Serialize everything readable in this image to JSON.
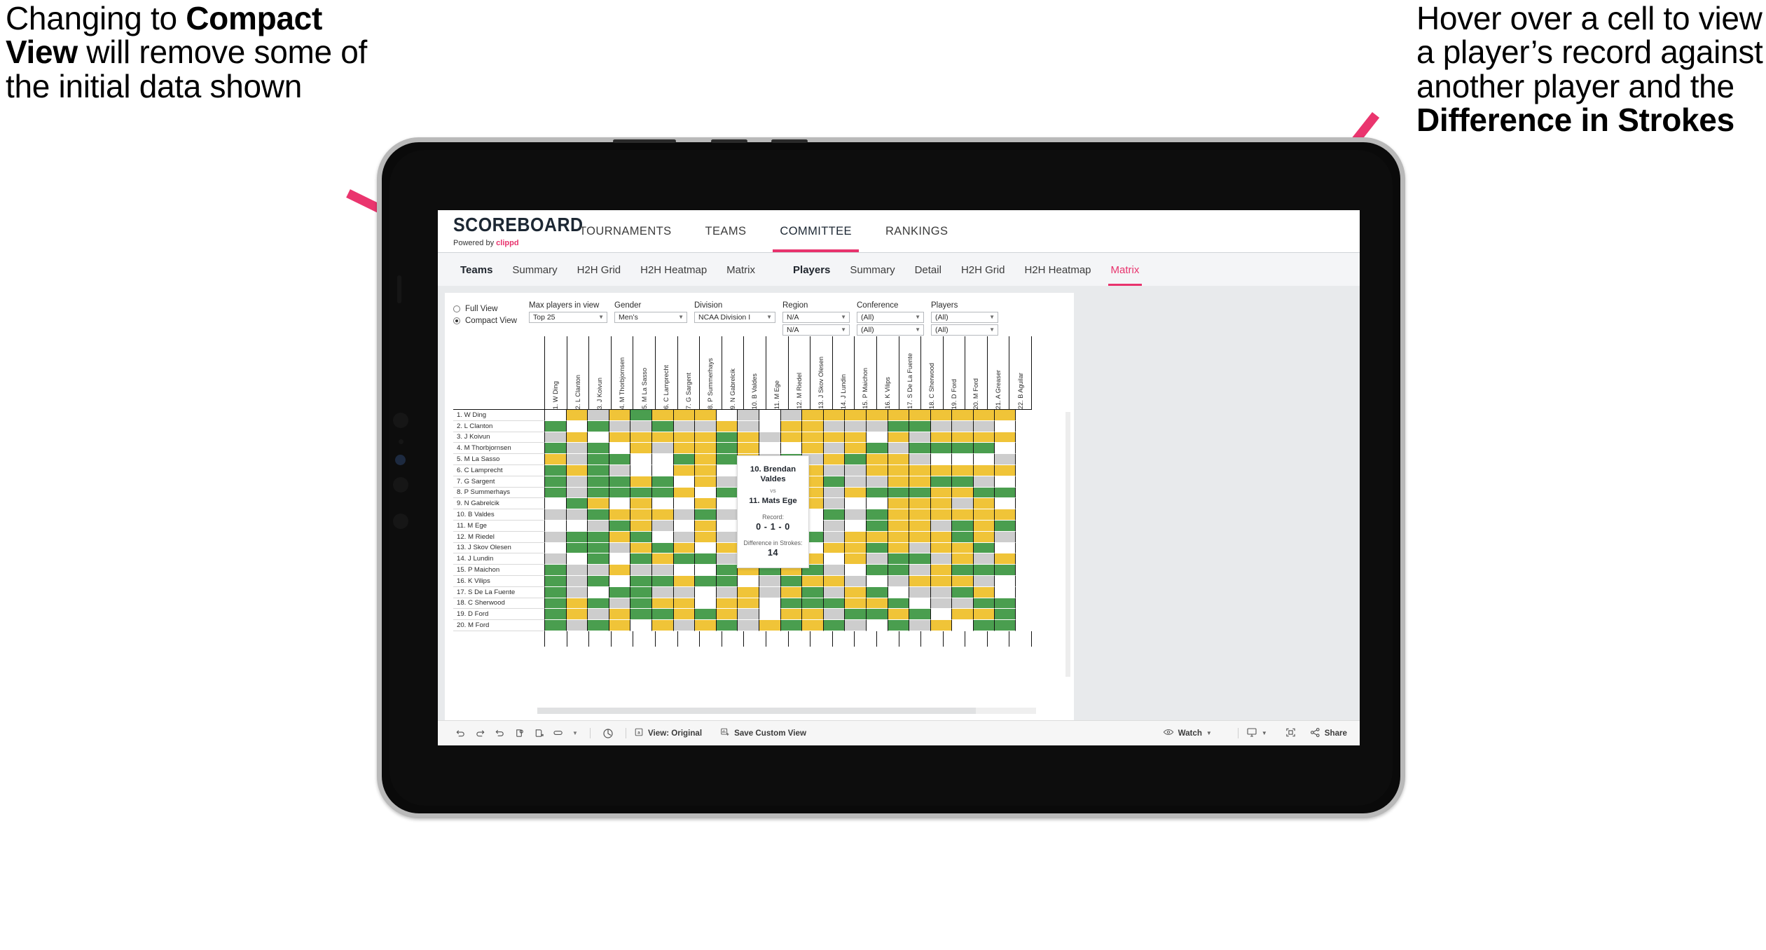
{
  "annotations": {
    "left": {
      "line1": "Changing to ",
      "bold": "Compact View",
      "line2": " will remove some of the initial data shown"
    },
    "right": {
      "line1": "Hover over a cell to view a player’s record against another player and the ",
      "bold": "Difference in Strokes"
    },
    "arrow_color": "#ea356e"
  },
  "app": {
    "brand": {
      "title": "SCOREBOARD",
      "powered_prefix": "Powered by ",
      "powered_name": "clippd"
    },
    "topnav": [
      {
        "label": "TOURNAMENTS",
        "active": false
      },
      {
        "label": "TEAMS",
        "active": false
      },
      {
        "label": "COMMITTEE",
        "active": true
      },
      {
        "label": "RANKINGS",
        "active": false
      }
    ],
    "subnav": {
      "teams_group": {
        "head": "Teams",
        "items": [
          "Summary",
          "H2H Grid",
          "H2H Heatmap",
          "Matrix"
        ]
      },
      "players_group": {
        "head": "Players",
        "items": [
          "Summary",
          "Detail",
          "H2H Grid",
          "H2H Heatmap",
          "Matrix"
        ],
        "active": "Matrix"
      }
    },
    "filters": {
      "view_mode": {
        "full": "Full View",
        "compact": "Compact View",
        "selected": "Compact View"
      },
      "max_players": {
        "label": "Max players in view",
        "value": "Top 25"
      },
      "gender": {
        "label": "Gender",
        "value": "Men’s"
      },
      "division": {
        "label": "Division",
        "value": "NCAA Division I"
      },
      "region": {
        "label": "Region",
        "value1": "N/A",
        "value2": "N/A"
      },
      "conference": {
        "label": "Conference",
        "value1": "(All)",
        "value2": "(All)"
      },
      "players": {
        "label": "Players",
        "value1": "(All)",
        "value2": "(All)"
      }
    },
    "tooltip": {
      "player_a": "10. Brendan Valdes",
      "vs": "vs",
      "player_b": "11. Mats Ege",
      "record_label": "Record:",
      "record_value": "0 - 1 - 0",
      "strokes_label": "Difference in Strokes:",
      "strokes_value": "14"
    },
    "toolbar": {
      "icons": [
        "undo-icon",
        "redo-icon",
        "revert-icon",
        "refresh-data-icon",
        "pause-updates-icon",
        "highlight-icon",
        "dropdown-caret-icon"
      ],
      "help_icon": "help-icon",
      "view_label": "View: Original",
      "save_label": "Save Custom View",
      "watch_label": "Watch",
      "share_label": "Share",
      "device_icon": "device-preview-icon",
      "fullscreen_icon": "fullscreen-icon"
    }
  },
  "chart_data": {
    "type": "heatmap",
    "title": "Player Head-to-Head Matrix",
    "legend": {
      "win": "#4a9e4f",
      "loss": "#f0c438",
      "no-data": "#cdcdcd",
      "self": "#ffffff"
    },
    "row_labels": [
      "1. W Ding",
      "2. L Clanton",
      "3. J Koivun",
      "4. M Thorbjornsen",
      "5. M La Sasso",
      "6. C Lamprecht",
      "7. G Sargent",
      "8. P Summerhays",
      "9. N Gabrelcik",
      "10. B Valdes",
      "11. M Ege",
      "12. M Riedel",
      "13. J Skov Olesen",
      "14. J Lundin",
      "15. P Maichon",
      "16. K Vilips",
      "17. S De La Fuente",
      "18. C Sherwood",
      "19. D Ford",
      "20. M Ford"
    ],
    "column_labels": [
      "1. W Ding",
      "2. L Clanton",
      "3. J Koivun",
      "4. M Thorbjornsen",
      "5. M La Sasso",
      "6. C Lamprecht",
      "7. G Sargent",
      "8. P Summerhays",
      "9. N Gabrelcik",
      "10. B Valdes",
      "11. M Ege",
      "12. M Riedel",
      "13. J Skov Olesen",
      "14. J Lundin",
      "15. P Maichon",
      "16. K Vilips",
      "17. S De La Fuente",
      "18. C Sherwood",
      "19. D Ford",
      "20. M Ford",
      "21. A Greaser",
      "22. B Aguilar"
    ],
    "cells": [
      [
        "w",
        "y",
        "n",
        "y",
        "g",
        "y",
        "y",
        "y",
        "w",
        "n",
        "w",
        "n",
        "y",
        "y",
        "y",
        "y",
        "y",
        "y",
        "y",
        "y",
        "y",
        "y"
      ],
      [
        "g",
        "w",
        "g",
        "n",
        "n",
        "g",
        "n",
        "n",
        "y",
        "n",
        "w",
        "y",
        "y",
        "n",
        "n",
        "n",
        "g",
        "g",
        "n",
        "n",
        "n",
        "w"
      ],
      [
        "n",
        "y",
        "w",
        "y",
        "y",
        "y",
        "y",
        "y",
        "g",
        "y",
        "n",
        "y",
        "y",
        "y",
        "y",
        "w",
        "y",
        "n",
        "y",
        "y",
        "y",
        "y"
      ],
      [
        "g",
        "n",
        "g",
        "w",
        "y",
        "n",
        "y",
        "y",
        "g",
        "y",
        "w",
        "w",
        "y",
        "n",
        "y",
        "g",
        "n",
        "g",
        "g",
        "g",
        "g",
        "w"
      ],
      [
        "y",
        "n",
        "g",
        "g",
        "w",
        "w",
        "g",
        "y",
        "g",
        "y",
        "n",
        "g",
        "n",
        "y",
        "g",
        "y",
        "y",
        "n",
        "w",
        "w",
        "w",
        "n"
      ],
      [
        "g",
        "y",
        "g",
        "n",
        "w",
        "w",
        "y",
        "y",
        "w",
        "g",
        "g",
        "n",
        "y",
        "n",
        "n",
        "y",
        "y",
        "y",
        "y",
        "y",
        "y",
        "y"
      ],
      [
        "g",
        "n",
        "g",
        "g",
        "y",
        "g",
        "w",
        "y",
        "n",
        "g",
        "g",
        "n",
        "y",
        "g",
        "n",
        "n",
        "y",
        "y",
        "g",
        "g",
        "n",
        "w"
      ],
      [
        "g",
        "n",
        "g",
        "g",
        "g",
        "g",
        "y",
        "w",
        "g",
        "y",
        "w",
        "g",
        "y",
        "n",
        "y",
        "g",
        "g",
        "g",
        "y",
        "y",
        "g",
        "g"
      ],
      [
        "w",
        "g",
        "y",
        "w",
        "y",
        "w",
        "w",
        "y",
        "w",
        "n",
        "g",
        "y",
        "y",
        "n",
        "w",
        "w",
        "y",
        "y",
        "y",
        "n",
        "y",
        "w"
      ],
      [
        "n",
        "n",
        "g",
        "y",
        "y",
        "y",
        "n",
        "g",
        "n",
        "w",
        "g",
        "y",
        "w",
        "g",
        "n",
        "g",
        "y",
        "y",
        "y",
        "y",
        "y",
        "y"
      ],
      [
        "w",
        "w",
        "n",
        "g",
        "y",
        "n",
        "w",
        "y",
        "w",
        "y",
        "w",
        "g",
        "w",
        "n",
        "w",
        "g",
        "y",
        "y",
        "n",
        "g",
        "y",
        "g"
      ],
      [
        "n",
        "g",
        "g",
        "y",
        "g",
        "w",
        "n",
        "y",
        "n",
        "y",
        "n",
        "w",
        "g",
        "n",
        "y",
        "y",
        "y",
        "y",
        "y",
        "g",
        "y",
        "n"
      ],
      [
        "w",
        "g",
        "g",
        "n",
        "y",
        "g",
        "y",
        "w",
        "y",
        "w",
        "n",
        "g",
        "w",
        "y",
        "y",
        "g",
        "y",
        "n",
        "y",
        "y",
        "g",
        "w"
      ],
      [
        "n",
        "w",
        "g",
        "w",
        "g",
        "y",
        "g",
        "g",
        "n",
        "y",
        "n",
        "y",
        "y",
        "w",
        "y",
        "n",
        "g",
        "g",
        "n",
        "y",
        "n",
        "y"
      ],
      [
        "g",
        "n",
        "n",
        "y",
        "n",
        "n",
        "w",
        "w",
        "g",
        "y",
        "g",
        "y",
        "g",
        "n",
        "w",
        "g",
        "g",
        "n",
        "y",
        "g",
        "g",
        "g"
      ],
      [
        "g",
        "n",
        "g",
        "w",
        "g",
        "g",
        "y",
        "g",
        "g",
        "w",
        "n",
        "g",
        "y",
        "y",
        "n",
        "w",
        "n",
        "y",
        "y",
        "y",
        "n",
        "w"
      ],
      [
        "g",
        "n",
        "w",
        "g",
        "g",
        "n",
        "n",
        "w",
        "n",
        "y",
        "n",
        "y",
        "g",
        "n",
        "y",
        "g",
        "w",
        "n",
        "n",
        "g",
        "y",
        "w"
      ],
      [
        "g",
        "y",
        "g",
        "n",
        "g",
        "y",
        "y",
        "w",
        "y",
        "y",
        "w",
        "g",
        "g",
        "g",
        "y",
        "y",
        "g",
        "w",
        "n",
        "n",
        "g",
        "g"
      ],
      [
        "g",
        "y",
        "n",
        "y",
        "g",
        "g",
        "y",
        "g",
        "y",
        "n",
        "w",
        "y",
        "y",
        "n",
        "g",
        "g",
        "y",
        "g",
        "w",
        "y",
        "y",
        "g"
      ],
      [
        "g",
        "n",
        "g",
        "y",
        "w",
        "y",
        "n",
        "y",
        "g",
        "n",
        "y",
        "g",
        "y",
        "g",
        "n",
        "w",
        "g",
        "n",
        "y",
        "w",
        "g",
        "g"
      ]
    ]
  }
}
